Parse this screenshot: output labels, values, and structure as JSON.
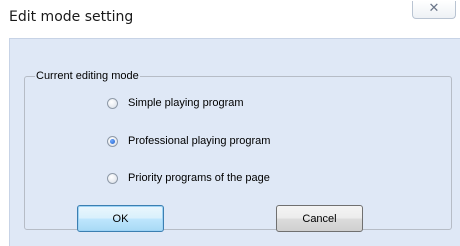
{
  "dialog": {
    "title": "Edit mode setting",
    "close_glyph": "✕",
    "group_label": "Current editing mode",
    "options": [
      {
        "label": "Simple playing program",
        "checked": false
      },
      {
        "label": "Professional playing program",
        "checked": true
      },
      {
        "label": "Priority programs of the page",
        "checked": false
      }
    ],
    "ok_label": "OK",
    "cancel_label": "Cancel"
  },
  "colors": {
    "client_background": "#dfe8f6",
    "default_button_border": "#3c7fb1"
  }
}
